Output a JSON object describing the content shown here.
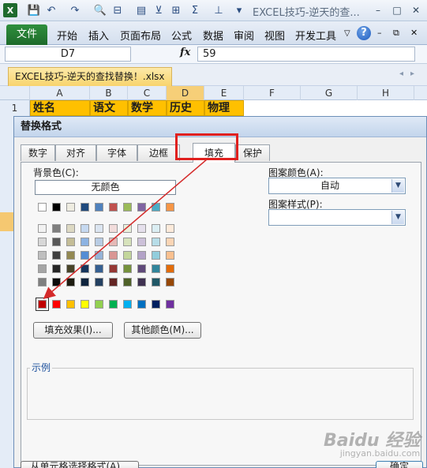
{
  "window": {
    "title": "EXCEL技巧-逆天的查...",
    "controls": [
      "–",
      "□",
      "✕"
    ]
  },
  "ribbon": {
    "file": "文件",
    "tabs": [
      "开始",
      "插入",
      "页面布局",
      "公式",
      "数据",
      "审阅",
      "视图",
      "开发工具"
    ]
  },
  "formula_bar": {
    "name_box": "D7",
    "fx": "fx",
    "value": "59"
  },
  "workbook": {
    "tab": "EXCEL技巧-逆天的查找替换！.xlsx"
  },
  "sheet": {
    "columns": [
      "A",
      "B",
      "C",
      "D",
      "E",
      "F",
      "G",
      "H"
    ],
    "row_label": "1",
    "header_cells": [
      "姓名",
      "语文",
      "数学",
      "历史",
      "物理"
    ]
  },
  "dialog": {
    "title": "替换格式",
    "tabs": [
      "数字",
      "对齐",
      "字体",
      "边框",
      "填充",
      "保护"
    ],
    "active_tab": "填充",
    "background_label": "背景色(C):",
    "no_color": "无颜色",
    "pattern_color_label": "图案颜色(A):",
    "pattern_color_value": "自动",
    "pattern_style_label": "图案样式(P):",
    "pattern_style_value": "",
    "fill_effects": "填充效果(I)...",
    "more_colors": "其他颜色(M)...",
    "sample_label": "示例",
    "bottom_left_button": "从单元格选择格式(A)...",
    "ok": "确定"
  },
  "palette": {
    "theme_top": [
      "#ffffff",
      "#000000",
      "#eeece1",
      "#1f497d",
      "#4f81bd",
      "#c0504d",
      "#9bbb59",
      "#8064a2",
      "#4bacc6",
      "#f79646"
    ],
    "theme_shades": [
      [
        "#f2f2f2",
        "#7f7f7f",
        "#ddd9c3",
        "#c6d9f0",
        "#dbe5f1",
        "#f2dcdb",
        "#ebf1dd",
        "#e5e0ec",
        "#dbeef3",
        "#fdeada"
      ],
      [
        "#d8d8d8",
        "#595959",
        "#c4bd97",
        "#8db3e2",
        "#b8cce4",
        "#e5b9b7",
        "#d7e3bc",
        "#ccc1d9",
        "#b7dde8",
        "#fbd5b5"
      ],
      [
        "#bfbfbf",
        "#3f3f3f",
        "#938953",
        "#548dd4",
        "#95b3d7",
        "#d99694",
        "#c3d69b",
        "#b2a2c7",
        "#92cddc",
        "#fac08f"
      ],
      [
        "#a5a5a5",
        "#262626",
        "#494429",
        "#17365d",
        "#366092",
        "#953734",
        "#76923c",
        "#5f497a",
        "#31859b",
        "#e36c09"
      ],
      [
        "#7f7f7f",
        "#0c0c0c",
        "#1d1b10",
        "#0f243e",
        "#244061",
        "#632423",
        "#4f6128",
        "#3f3151",
        "#205867",
        "#974806"
      ]
    ],
    "standard": [
      "#c00000",
      "#ff0000",
      "#ffc000",
      "#ffff00",
      "#92d050",
      "#00b050",
      "#00b0f0",
      "#0070c0",
      "#002060",
      "#7030a0"
    ],
    "selected_standard_index": 0
  },
  "watermark": {
    "brand": "Baidu 经验",
    "url": "jingyan.baidu.com"
  }
}
